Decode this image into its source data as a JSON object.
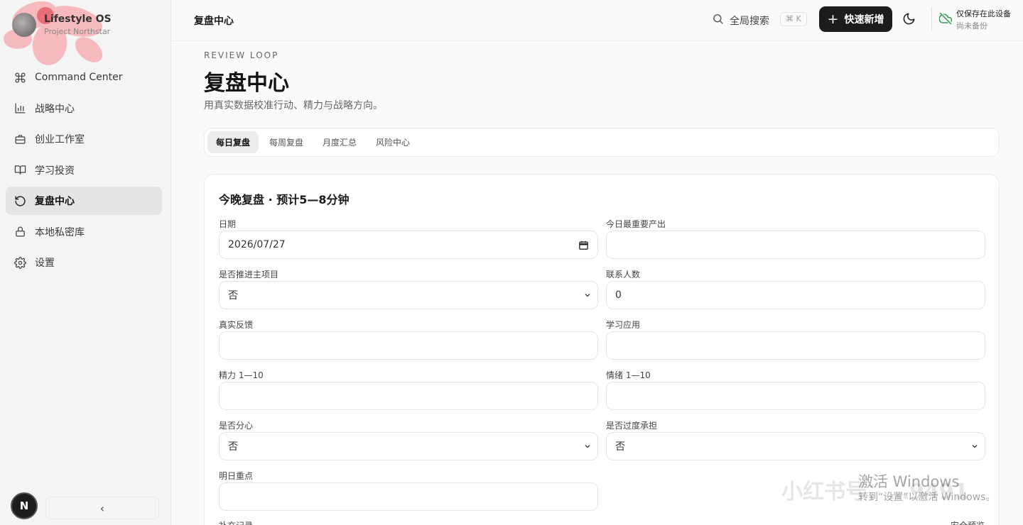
{
  "brand": {
    "name": "Lifestyle OS",
    "sub": "Project Northstar"
  },
  "nav": [
    {
      "label": "Command Center",
      "icon": "command-icon"
    },
    {
      "label": "战略中心",
      "icon": "bar-chart-icon"
    },
    {
      "label": "创业工作室",
      "icon": "briefcase-icon"
    },
    {
      "label": "学习投资",
      "icon": "book-open-icon"
    },
    {
      "label": "复盘中心",
      "icon": "rotate-ccw-icon",
      "active": true
    },
    {
      "label": "本地私密库",
      "icon": "lock-icon"
    },
    {
      "label": "设置",
      "icon": "gear-icon"
    }
  ],
  "user": {
    "initial": "N"
  },
  "sidebar_collapse": "‹",
  "topbar": {
    "breadcrumb": "复盘中心",
    "search_label": "全局搜索",
    "shortcut": "⌘ K",
    "quick_add": "快速新增",
    "storage_status": "仅保存在此设备",
    "backup_status": "尚未备份"
  },
  "page": {
    "eyebrow": "REVIEW LOOP",
    "title": "复盘中心",
    "subtitle": "用真实数据校准行动、精力与战略方向。"
  },
  "tabs": [
    {
      "label": "每日复盘",
      "active": true
    },
    {
      "label": "每周复盘"
    },
    {
      "label": "月度汇总"
    },
    {
      "label": "风险中心"
    }
  ],
  "form": {
    "title": "今晚复盘 · 预计5—8分钟",
    "fields": {
      "date": {
        "label": "日期",
        "value": "2026/07/27"
      },
      "top_output": {
        "label": "今日最重要产出",
        "value": ""
      },
      "main_project": {
        "label": "是否推进主项目",
        "value": "否"
      },
      "contacts": {
        "label": "联系人数",
        "value": "0"
      },
      "feedback": {
        "label": "真实反馈",
        "value": ""
      },
      "learning": {
        "label": "学习应用",
        "value": ""
      },
      "energy": {
        "label": "精力 1—10",
        "value": ""
      },
      "mood": {
        "label": "情绪 1—10",
        "value": ""
      },
      "distracted": {
        "label": "是否分心",
        "value": "否"
      },
      "overload": {
        "label": "是否过度承担",
        "value": "否"
      },
      "tomorrow": {
        "label": "明日重点",
        "value": ""
      }
    },
    "extra_label": "补充记录",
    "preview_label": "安全预览"
  },
  "overlay": {
    "watermark": "小红书号：…9491",
    "activate_title": "激活 Windows",
    "activate_sub": "转到“设置”以激活 Windows。"
  }
}
